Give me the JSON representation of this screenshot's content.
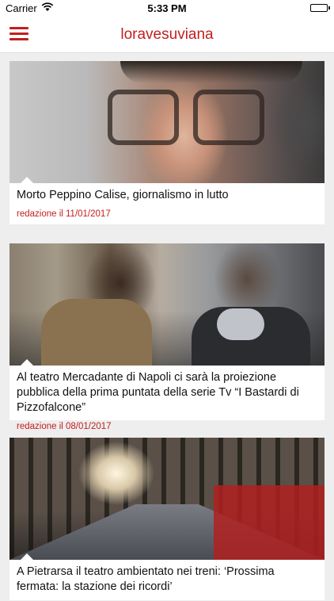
{
  "status_bar": {
    "carrier": "Carrier",
    "time": "5:33 PM",
    "battery_level": 1.0
  },
  "nav": {
    "title": "loravesuviana",
    "menu_icon": "hamburger-icon"
  },
  "colors": {
    "accent": "#c41e1e",
    "background": "#eeeeee",
    "card": "#ffffff"
  },
  "articles": [
    {
      "title": "Morto Peppino Calise, giornalismo in lutto",
      "meta": "redazione il 11/01/2017"
    },
    {
      "title": "Al teatro Mercadante di Napoli ci sarà la proiezione pubblica della prima puntata della serie Tv “I Bastardi di Pizzofalcone”",
      "meta": "redazione il 08/01/2017"
    },
    {
      "title": "A Pietrarsa il  teatro ambientato nei treni: ‘Prossima fermata: la stazione dei ricordi’",
      "meta": ""
    }
  ]
}
